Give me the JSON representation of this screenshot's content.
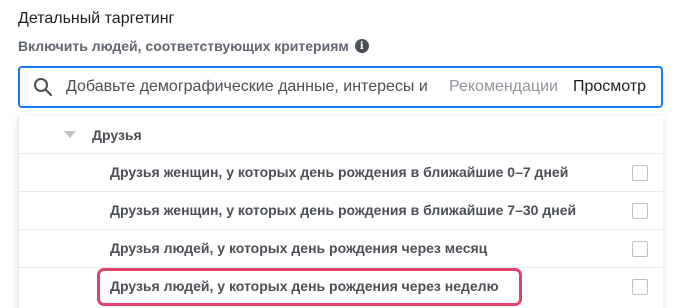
{
  "header": {
    "title": "Детальный таргетинг",
    "subtitle": "Включить людей, соответствующих критериям"
  },
  "search": {
    "value": "Добавьте демографические данные, интересы и",
    "recommendations_label": "Рекомендации",
    "browse_label": "Просмотр"
  },
  "dropdown": {
    "group_label": "Друзья",
    "items": [
      {
        "label": "Друзья женщин, у которых день рождения в ближайшие 0–7 дней",
        "checked": false
      },
      {
        "label": "Друзья женщин, у которых день рождения в ближайшие 7–30 дней",
        "checked": false
      },
      {
        "label": "Друзья людей, у которых день рождения через месяц",
        "checked": false
      },
      {
        "label": "Друзья людей, у которых день рождения через неделю",
        "checked": false,
        "highlighted": true
      }
    ]
  },
  "colors": {
    "accent": "#1877f2",
    "highlight": "#e0426a"
  }
}
